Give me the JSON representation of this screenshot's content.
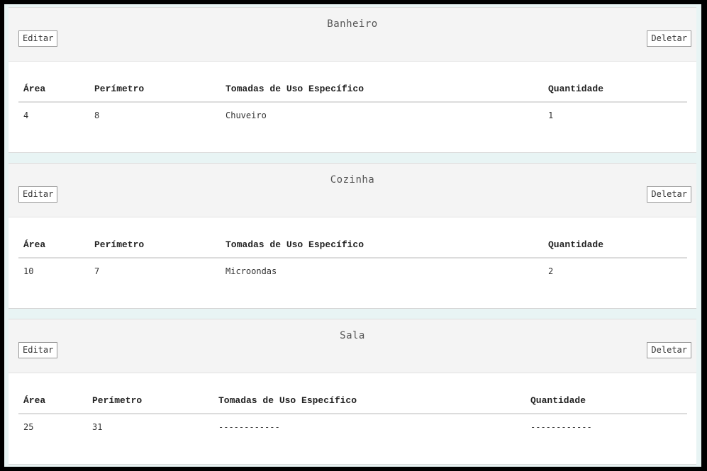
{
  "rooms": [
    {
      "title": "Banheiro",
      "edit_label": "Editar",
      "delete_label": "Deletar",
      "headers": [
        "Área",
        "Perímetro",
        "Tomadas de Uso Específico",
        "Quantidade"
      ],
      "row": [
        "4",
        "8",
        "Chuveiro",
        "1"
      ]
    },
    {
      "title": "Cozinha",
      "edit_label": "Editar",
      "delete_label": "Deletar",
      "headers": [
        "Área",
        "Perímetro",
        "Tomadas de Uso Específico",
        "Quantidade"
      ],
      "row": [
        "10",
        "7",
        "Microondas",
        "2"
      ]
    },
    {
      "title": "Sala",
      "edit_label": "Editar",
      "delete_label": "Deletar",
      "headers": [
        "Área",
        "Perímetro",
        "Tomadas de Uso Específico",
        "Quantidade"
      ],
      "row": [
        "25",
        "31",
        "------------",
        "------------"
      ]
    }
  ]
}
